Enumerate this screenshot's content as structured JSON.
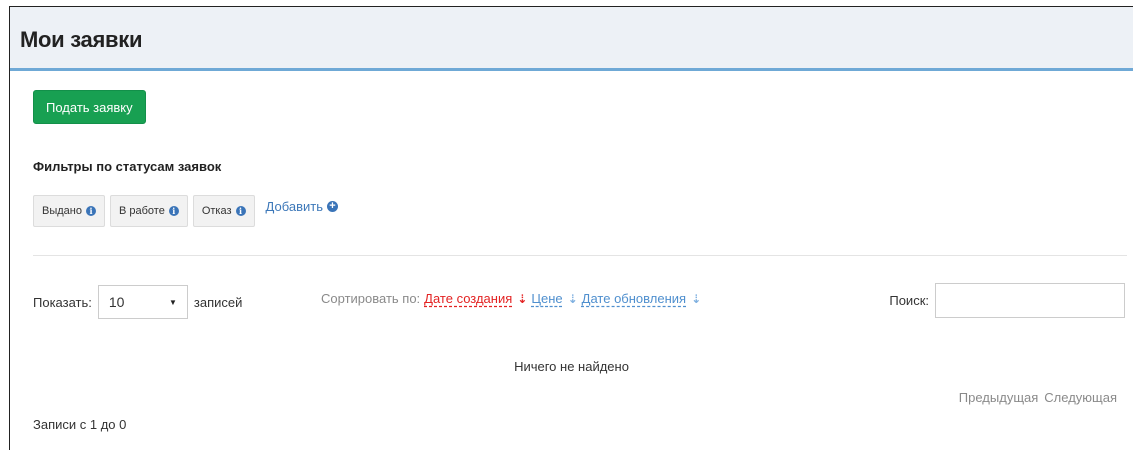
{
  "page": {
    "title": "Мои заявки"
  },
  "toolbar": {
    "submit_label": "Подать заявку"
  },
  "filters": {
    "title": "Фильтры по статусам заявок",
    "items": [
      {
        "label": "Выдано",
        "icon": "info-icon"
      },
      {
        "label": "В работе",
        "icon": "info-icon"
      },
      {
        "label": "Отказ",
        "icon": "info-icon"
      }
    ],
    "add_label": "Добавить",
    "add_icon": "plus-circle-icon"
  },
  "table": {
    "show_label": "Показать:",
    "page_length": "10",
    "records_label": "записей",
    "sort_label": "Сортировать по:",
    "sort_options": [
      {
        "label": "Дате создания",
        "active": true
      },
      {
        "label": "Цене",
        "active": false
      },
      {
        "label": "Дате обновления",
        "active": false
      }
    ],
    "search_label": "Поиск:",
    "search_value": "",
    "empty_text": "Ничего не найдено",
    "info_text": "Записи с 1 до 0",
    "prev_label": "Предыдущая",
    "next_label": "Следующая"
  },
  "colors": {
    "primary_green": "#18a052",
    "header_bg": "#edf1f6",
    "header_border": "#6fa9d6",
    "link_blue": "#4f8fce",
    "active_red": "#e32222"
  }
}
